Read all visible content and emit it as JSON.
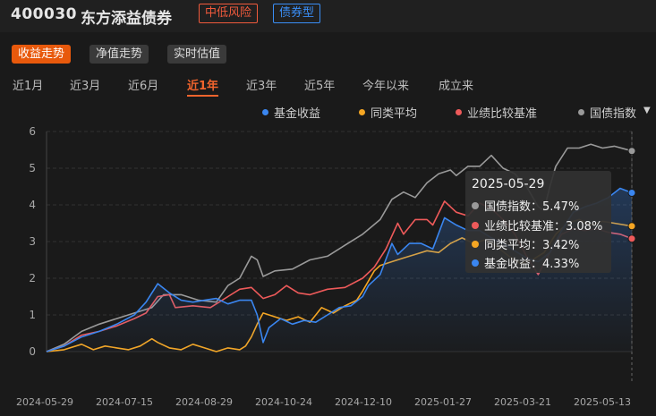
{
  "header": {
    "code": "400030",
    "name": "东方添益债券",
    "risk_tag": "中低风险",
    "type_tag": "债券型"
  },
  "view_buttons": [
    {
      "label": "收益走势",
      "active": true
    },
    {
      "label": "净值走势",
      "active": false
    },
    {
      "label": "实时估值",
      "active": false
    }
  ],
  "periods": [
    {
      "label": "近1月",
      "active": false
    },
    {
      "label": "近3月",
      "active": false
    },
    {
      "label": "近6月",
      "active": false
    },
    {
      "label": "近1年",
      "active": true
    },
    {
      "label": "近3年",
      "active": false
    },
    {
      "label": "近5年",
      "active": false
    },
    {
      "label": "今年以来",
      "active": false
    },
    {
      "label": "成立来",
      "active": false
    }
  ],
  "legend": [
    {
      "label": "基金收益",
      "color": "#3a86f0"
    },
    {
      "label": "同类平均",
      "color": "#f5a623"
    },
    {
      "label": "业绩比较基准",
      "color": "#ee5a5a"
    },
    {
      "label": "国债指数",
      "color": "#9a9a9a"
    }
  ],
  "tooltip": {
    "date": "2025-05-29",
    "rows": [
      {
        "label": "国债指数：5.47%",
        "color": "#9a9a9a"
      },
      {
        "label": "业绩比较基准：3.08%",
        "color": "#ee5a5a"
      },
      {
        "label": "同类平均：3.42%",
        "color": "#f5a623"
      },
      {
        "label": "基金收益：4.33%",
        "color": "#3a86f0"
      }
    ]
  },
  "chart_data": {
    "type": "line",
    "ylim": [
      0,
      6
    ],
    "yticks": [
      "0",
      "1",
      "2",
      "3",
      "4",
      "5",
      "6"
    ],
    "xticks": [
      "2024-05-29",
      "2024-07-15",
      "2024-08-29",
      "2024-10-24",
      "2024-12-10",
      "2025-01-27",
      "2025-03-21",
      "2025-05-13"
    ],
    "series": [
      {
        "name": "国债指数",
        "color": "#9a9a9a",
        "points": [
          [
            0,
            0
          ],
          [
            0.03,
            0.2
          ],
          [
            0.06,
            0.55
          ],
          [
            0.09,
            0.75
          ],
          [
            0.12,
            0.9
          ],
          [
            0.15,
            1.05
          ],
          [
            0.18,
            1.2
          ],
          [
            0.2,
            1.55
          ],
          [
            0.23,
            1.55
          ],
          [
            0.26,
            1.4
          ],
          [
            0.29,
            1.35
          ],
          [
            0.31,
            1.8
          ],
          [
            0.33,
            2.0
          ],
          [
            0.35,
            2.6
          ],
          [
            0.36,
            2.5
          ],
          [
            0.37,
            2.05
          ],
          [
            0.39,
            2.2
          ],
          [
            0.42,
            2.25
          ],
          [
            0.45,
            2.5
          ],
          [
            0.48,
            2.6
          ],
          [
            0.51,
            2.9
          ],
          [
            0.54,
            3.2
          ],
          [
            0.57,
            3.6
          ],
          [
            0.59,
            4.15
          ],
          [
            0.61,
            4.35
          ],
          [
            0.63,
            4.2
          ],
          [
            0.65,
            4.6
          ],
          [
            0.67,
            4.85
          ],
          [
            0.69,
            4.95
          ],
          [
            0.7,
            4.8
          ],
          [
            0.72,
            5.05
          ],
          [
            0.74,
            5.05
          ],
          [
            0.76,
            5.35
          ],
          [
            0.78,
            5.0
          ],
          [
            0.8,
            4.85
          ],
          [
            0.82,
            4.5
          ],
          [
            0.84,
            3.95
          ],
          [
            0.85,
            3.85
          ],
          [
            0.86,
            4.5
          ],
          [
            0.87,
            5.05
          ],
          [
            0.89,
            5.55
          ],
          [
            0.91,
            5.55
          ],
          [
            0.93,
            5.65
          ],
          [
            0.95,
            5.55
          ],
          [
            0.97,
            5.6
          ],
          [
            1.0,
            5.47
          ]
        ]
      },
      {
        "name": "业绩比较基准",
        "color": "#ee5a5a",
        "points": [
          [
            0,
            0
          ],
          [
            0.03,
            0.15
          ],
          [
            0.06,
            0.45
          ],
          [
            0.09,
            0.55
          ],
          [
            0.12,
            0.7
          ],
          [
            0.15,
            0.9
          ],
          [
            0.17,
            1.05
          ],
          [
            0.19,
            1.5
          ],
          [
            0.21,
            1.55
          ],
          [
            0.22,
            1.2
          ],
          [
            0.25,
            1.25
          ],
          [
            0.28,
            1.2
          ],
          [
            0.31,
            1.5
          ],
          [
            0.33,
            1.7
          ],
          [
            0.35,
            1.75
          ],
          [
            0.37,
            1.45
          ],
          [
            0.39,
            1.55
          ],
          [
            0.41,
            1.8
          ],
          [
            0.43,
            1.6
          ],
          [
            0.45,
            1.55
          ],
          [
            0.48,
            1.7
          ],
          [
            0.51,
            1.75
          ],
          [
            0.54,
            2.0
          ],
          [
            0.56,
            2.3
          ],
          [
            0.58,
            2.8
          ],
          [
            0.6,
            3.5
          ],
          [
            0.61,
            3.2
          ],
          [
            0.63,
            3.6
          ],
          [
            0.65,
            3.6
          ],
          [
            0.66,
            3.45
          ],
          [
            0.68,
            4.1
          ],
          [
            0.7,
            3.8
          ],
          [
            0.72,
            3.7
          ],
          [
            0.74,
            4.05
          ],
          [
            0.76,
            3.9
          ],
          [
            0.78,
            3.6
          ],
          [
            0.8,
            3.2
          ],
          [
            0.82,
            2.6
          ],
          [
            0.84,
            2.1
          ],
          [
            0.86,
            2.7
          ],
          [
            0.88,
            3.2
          ],
          [
            0.9,
            3.35
          ],
          [
            0.92,
            3.3
          ],
          [
            0.94,
            3.35
          ],
          [
            0.96,
            3.25
          ],
          [
            0.98,
            3.2
          ],
          [
            1.0,
            3.08
          ]
        ]
      },
      {
        "name": "同类平均",
        "color": "#f5a623",
        "points": [
          [
            0,
            0
          ],
          [
            0.03,
            0.05
          ],
          [
            0.06,
            0.2
          ],
          [
            0.08,
            0.05
          ],
          [
            0.1,
            0.15
          ],
          [
            0.12,
            0.1
          ],
          [
            0.14,
            0.05
          ],
          [
            0.16,
            0.15
          ],
          [
            0.18,
            0.35
          ],
          [
            0.19,
            0.25
          ],
          [
            0.21,
            0.1
          ],
          [
            0.23,
            0.05
          ],
          [
            0.25,
            0.2
          ],
          [
            0.27,
            0.1
          ],
          [
            0.29,
            0.0
          ],
          [
            0.31,
            0.1
          ],
          [
            0.33,
            0.05
          ],
          [
            0.34,
            0.15
          ],
          [
            0.35,
            0.4
          ],
          [
            0.36,
            0.75
          ],
          [
            0.37,
            1.05
          ],
          [
            0.39,
            0.95
          ],
          [
            0.41,
            0.85
          ],
          [
            0.43,
            0.95
          ],
          [
            0.45,
            0.8
          ],
          [
            0.47,
            1.2
          ],
          [
            0.49,
            1.05
          ],
          [
            0.51,
            1.25
          ],
          [
            0.53,
            1.4
          ],
          [
            0.54,
            1.65
          ],
          [
            0.56,
            2.2
          ],
          [
            0.57,
            2.35
          ],
          [
            0.59,
            2.45
          ],
          [
            0.61,
            2.55
          ],
          [
            0.63,
            2.65
          ],
          [
            0.65,
            2.75
          ],
          [
            0.67,
            2.7
          ],
          [
            0.69,
            2.95
          ],
          [
            0.71,
            3.1
          ],
          [
            0.73,
            2.95
          ],
          [
            0.75,
            3.05
          ],
          [
            0.77,
            2.85
          ],
          [
            0.79,
            2.6
          ],
          [
            0.81,
            2.4
          ],
          [
            0.83,
            2.5
          ],
          [
            0.85,
            2.7
          ],
          [
            0.87,
            3.2
          ],
          [
            0.89,
            3.5
          ],
          [
            0.91,
            3.6
          ],
          [
            0.93,
            3.45
          ],
          [
            0.95,
            3.55
          ],
          [
            0.97,
            3.5
          ],
          [
            1.0,
            3.42
          ]
        ]
      },
      {
        "name": "基金收益",
        "color": "#3a86f0",
        "area": true,
        "points": [
          [
            0,
            0
          ],
          [
            0.03,
            0.15
          ],
          [
            0.06,
            0.4
          ],
          [
            0.09,
            0.55
          ],
          [
            0.12,
            0.75
          ],
          [
            0.15,
            1.0
          ],
          [
            0.17,
            1.35
          ],
          [
            0.19,
            1.85
          ],
          [
            0.21,
            1.6
          ],
          [
            0.23,
            1.4
          ],
          [
            0.25,
            1.35
          ],
          [
            0.27,
            1.4
          ],
          [
            0.29,
            1.45
          ],
          [
            0.31,
            1.3
          ],
          [
            0.33,
            1.4
          ],
          [
            0.35,
            1.4
          ],
          [
            0.36,
            1.0
          ],
          [
            0.37,
            0.25
          ],
          [
            0.38,
            0.65
          ],
          [
            0.4,
            0.9
          ],
          [
            0.42,
            0.75
          ],
          [
            0.44,
            0.85
          ],
          [
            0.46,
            0.8
          ],
          [
            0.48,
            1.0
          ],
          [
            0.5,
            1.2
          ],
          [
            0.52,
            1.25
          ],
          [
            0.54,
            1.5
          ],
          [
            0.55,
            1.8
          ],
          [
            0.57,
            2.1
          ],
          [
            0.59,
            2.95
          ],
          [
            0.6,
            2.65
          ],
          [
            0.62,
            2.95
          ],
          [
            0.64,
            2.95
          ],
          [
            0.66,
            2.8
          ],
          [
            0.68,
            3.65
          ],
          [
            0.7,
            3.45
          ],
          [
            0.72,
            3.3
          ],
          [
            0.74,
            3.3
          ],
          [
            0.76,
            3.1
          ],
          [
            0.78,
            2.95
          ],
          [
            0.8,
            2.75
          ],
          [
            0.82,
            2.55
          ],
          [
            0.84,
            2.45
          ],
          [
            0.86,
            2.7
          ],
          [
            0.88,
            3.3
          ],
          [
            0.9,
            3.8
          ],
          [
            0.92,
            3.95
          ],
          [
            0.94,
            4.05
          ],
          [
            0.96,
            4.2
          ],
          [
            0.98,
            4.45
          ],
          [
            1.0,
            4.33
          ]
        ]
      }
    ]
  }
}
